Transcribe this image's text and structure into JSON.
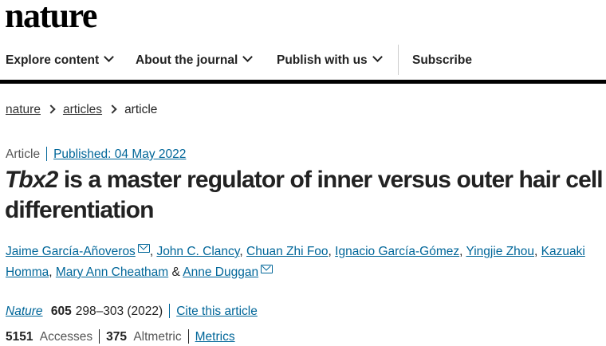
{
  "site": {
    "logo": "nature"
  },
  "nav": {
    "items": [
      {
        "label": "Explore content"
      },
      {
        "label": "About the journal"
      },
      {
        "label": "Publish with us"
      }
    ],
    "subscribe": "Subscribe"
  },
  "breadcrumb": [
    "nature",
    "articles",
    "article"
  ],
  "article": {
    "type": "Article",
    "published": "Published: 04 May 2022",
    "title_italic": "Tbx2",
    "title_rest": " is a master regulator of inner versus outer hair cell differentiation",
    "authors": [
      {
        "name": "Jaime García-Añoveros",
        "email": true
      },
      {
        "name": "John C. Clancy"
      },
      {
        "name": "Chuan Zhi Foo"
      },
      {
        "name": "Ignacio García-Gómez"
      },
      {
        "name": "Yingjie Zhou"
      },
      {
        "name": "Kazuaki Homma"
      },
      {
        "name": "Mary Ann Cheatham"
      },
      {
        "name": "Anne Duggan",
        "email": true
      }
    ],
    "journal": "Nature",
    "volume": "605",
    "pages_year": "298–303 (2022)",
    "cite_label": "Cite this article",
    "accesses_value": "5151",
    "accesses_label": "Accesses",
    "altmetric_value": "375",
    "altmetric_label": "Altmetric",
    "metrics_label": "Metrics"
  }
}
